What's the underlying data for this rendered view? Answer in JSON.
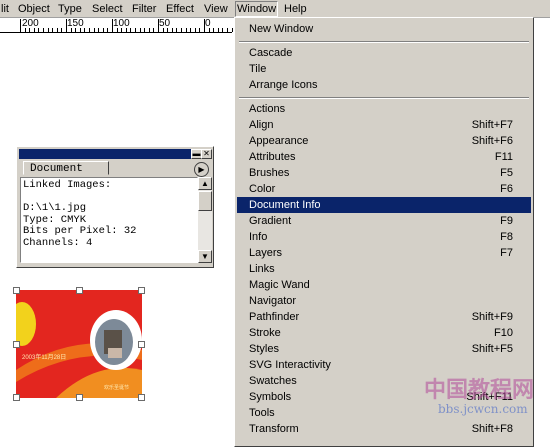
{
  "menubar": {
    "items": [
      "lit",
      "Object",
      "Type",
      "Select",
      "Filter",
      "Effect",
      "View",
      "Window",
      "Help"
    ],
    "active": "Window"
  },
  "ruler": {
    "labels": [
      "200",
      "150",
      "100",
      "50",
      "0"
    ]
  },
  "panel": {
    "tab_label": "Document Info",
    "lines": [
      "Linked Images:",
      "",
      "D:\\1\\1.jpg",
      "Type: CMYK",
      "Bits per Pixel: 32",
      "Channels: 4"
    ]
  },
  "thumbnail": {
    "caption_left": "2003年11月28日",
    "caption_bottom": "欢乐圣诞节"
  },
  "window_menu": {
    "items": [
      {
        "label": "New Window",
        "shortcut": ""
      },
      {
        "label": "Cascade",
        "shortcut": ""
      },
      {
        "label": "Tile",
        "shortcut": ""
      },
      {
        "label": "Arrange Icons",
        "shortcut": ""
      },
      {
        "label": "Actions",
        "shortcut": ""
      },
      {
        "label": "Align",
        "shortcut": "Shift+F7"
      },
      {
        "label": "Appearance",
        "shortcut": "Shift+F6"
      },
      {
        "label": "Attributes",
        "shortcut": "F11"
      },
      {
        "label": "Brushes",
        "shortcut": "F5"
      },
      {
        "label": "Color",
        "shortcut": "F6"
      },
      {
        "label": "Document Info",
        "shortcut": ""
      },
      {
        "label": "Gradient",
        "shortcut": "F9"
      },
      {
        "label": "Info",
        "shortcut": "F8"
      },
      {
        "label": "Layers",
        "shortcut": "F7"
      },
      {
        "label": "Links",
        "shortcut": ""
      },
      {
        "label": "Magic Wand",
        "shortcut": ""
      },
      {
        "label": "Navigator",
        "shortcut": ""
      },
      {
        "label": "Pathfinder",
        "shortcut": "Shift+F9"
      },
      {
        "label": "Stroke",
        "shortcut": "F10"
      },
      {
        "label": "Styles",
        "shortcut": "Shift+F5"
      },
      {
        "label": "SVG Interactivity",
        "shortcut": ""
      },
      {
        "label": "Swatches",
        "shortcut": ""
      },
      {
        "label": "Symbols",
        "shortcut": "Shift+F11"
      },
      {
        "label": "Tools",
        "shortcut": ""
      },
      {
        "label": "Transform",
        "shortcut": "Shift+F8"
      }
    ],
    "highlighted": "Document Info"
  },
  "watermark": {
    "title": "中国教程网",
    "url": "bbs.jcwcn.com"
  },
  "colors": {
    "menu_bg": "#d4d0c8",
    "highlight": "#0a246a",
    "thumbnail_red": "#e3261f"
  }
}
